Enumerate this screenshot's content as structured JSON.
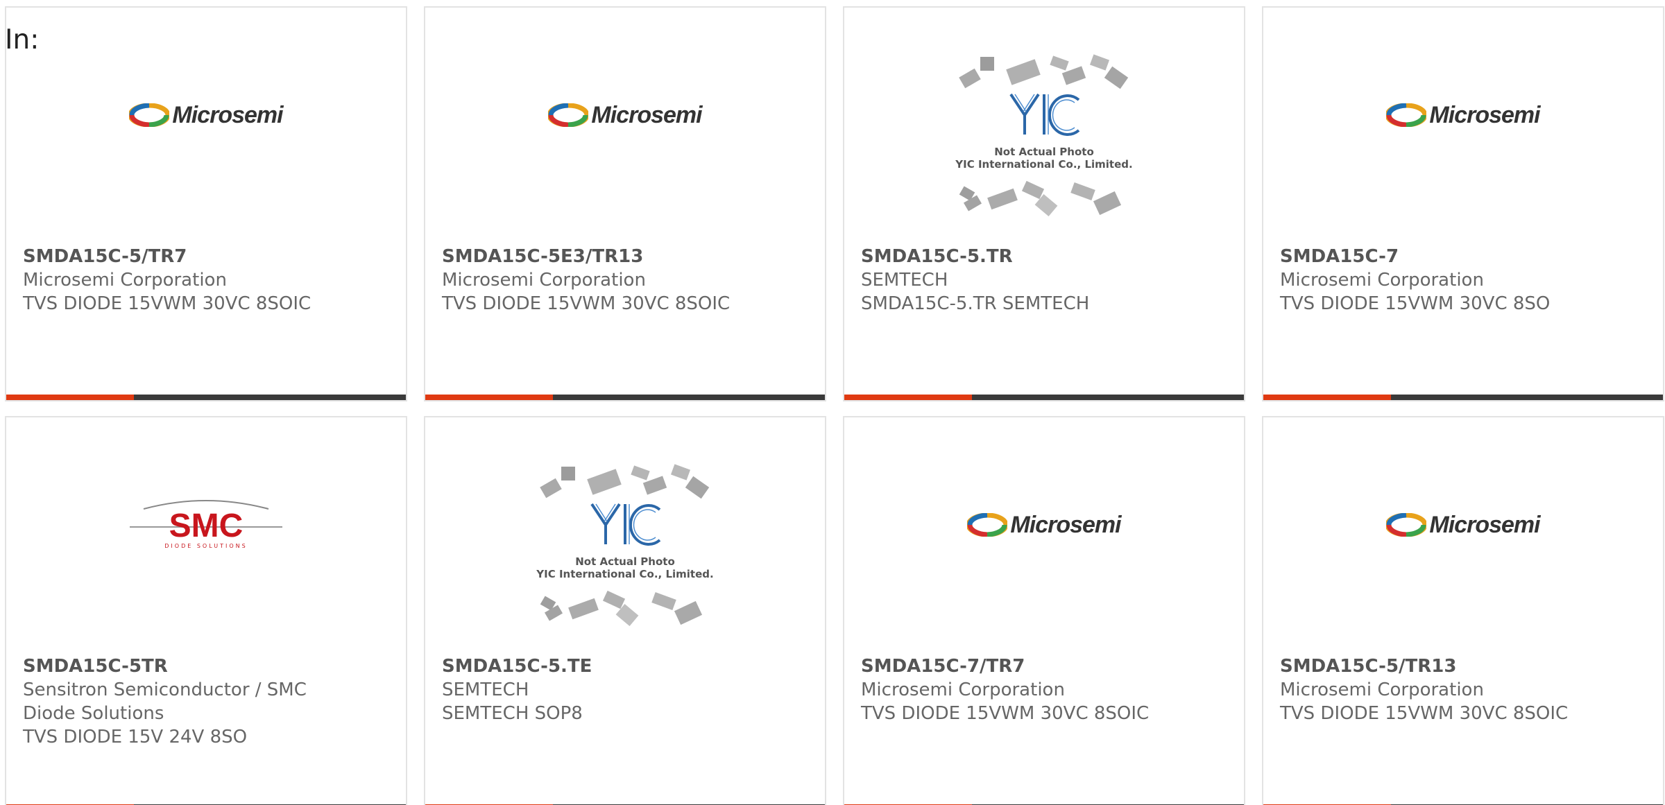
{
  "header": {
    "label": "In:"
  },
  "colors": {
    "accent": "#e03a12",
    "bar": "#3a3a3a",
    "border": "#e3e3e3"
  },
  "products": [
    {
      "part": "SMDA15C-5/TR7",
      "lines": [
        "Microsemi Corporation",
        "TVS DIODE 15VWM 30VC 8SOIC"
      ],
      "logo": "microsemi",
      "logo_text": "Microsemi"
    },
    {
      "part": "SMDA15C-5E3/TR13",
      "lines": [
        "Microsemi Corporation",
        "TVS DIODE 15VWM 30VC 8SOIC"
      ],
      "logo": "microsemi",
      "logo_text": "Microsemi"
    },
    {
      "part": "SMDA15C-5.TR",
      "lines": [
        "SEMTECH",
        "SMDA15C-5.TR SEMTECH"
      ],
      "logo": "yic",
      "logo_text": "Not Actual Photo",
      "logo_text2": "YIC International Co., Limited."
    },
    {
      "part": "SMDA15C-7",
      "lines": [
        "Microsemi Corporation",
        "TVS DIODE 15VWM 30VC 8SO"
      ],
      "logo": "microsemi",
      "logo_text": "Microsemi"
    },
    {
      "part": "SMDA15C-5TR",
      "lines": [
        "Sensitron Semiconductor / SMC",
        "Diode Solutions",
        "TVS DIODE 15V 24V 8SO"
      ],
      "logo": "smc",
      "logo_text": "SMC",
      "logo_text2": "DIODE SOLUTIONS"
    },
    {
      "part": "SMDA15C-5.TE",
      "lines": [
        "SEMTECH",
        "SEMTECH SOP8"
      ],
      "logo": "yic",
      "logo_text": "Not Actual Photo",
      "logo_text2": "YIC International Co., Limited."
    },
    {
      "part": "SMDA15C-7/TR7",
      "lines": [
        "Microsemi Corporation",
        "TVS DIODE 15VWM 30VC 8SOIC"
      ],
      "logo": "microsemi",
      "logo_text": "Microsemi"
    },
    {
      "part": "SMDA15C-5/TR13",
      "lines": [
        "Microsemi Corporation",
        "TVS DIODE 15VWM 30VC 8SOIC"
      ],
      "logo": "microsemi",
      "logo_text": "Microsemi"
    }
  ]
}
